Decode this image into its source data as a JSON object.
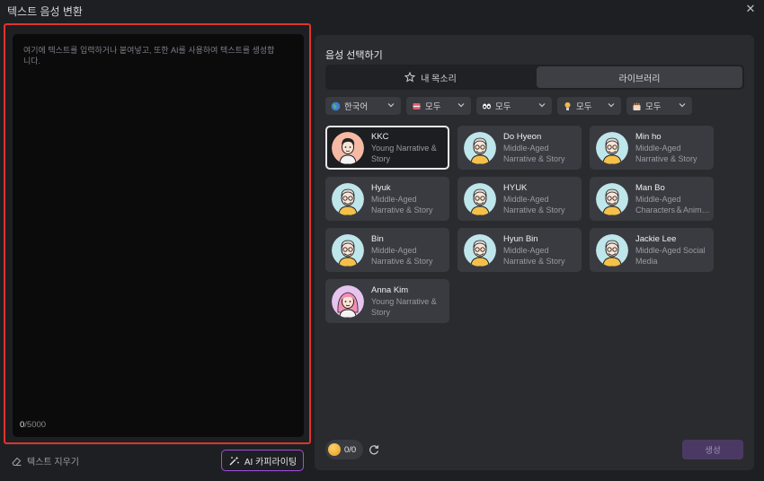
{
  "window": {
    "title": "텍스트 음성 변환",
    "close_icon": "close-icon"
  },
  "editor": {
    "placeholder": "여기에 텍스트를 입력하거나 붙여넣고, 또한 AI를 사용하여 텍스트를 생성합니다.",
    "count_current": "0",
    "count_max": "/5000"
  },
  "actions": {
    "clear_label": "텍스트 지우기",
    "ai_label": "AI 카피라이팅"
  },
  "voice_panel": {
    "title": "음성 선택하기",
    "tabs": [
      {
        "label": "내 목소리",
        "icon": "star-icon",
        "active": false
      },
      {
        "label": "라이브러리",
        "icon": "",
        "active": true
      }
    ],
    "filters": [
      {
        "label": "한국어",
        "icon": "globe-icon"
      },
      {
        "label": "모두",
        "icon": "gender-icon"
      },
      {
        "label": "모두",
        "icon": "age-icon"
      },
      {
        "label": "모두",
        "icon": "style-icon"
      },
      {
        "label": "모두",
        "icon": "scene-icon"
      }
    ],
    "voices": [
      {
        "name": "KKC",
        "desc": "Young Narrative & Story",
        "selected": true,
        "avatar": "young-male-avatar"
      },
      {
        "name": "Do Hyeon",
        "desc": "Middle-Aged Narrative & Story",
        "selected": false,
        "avatar": "middle-aged-male-avatar"
      },
      {
        "name": "Min ho",
        "desc": "Middle-Aged Narrative & Story",
        "selected": false,
        "avatar": "middle-aged-male-avatar"
      },
      {
        "name": "Hyuk",
        "desc": "Middle-Aged Narrative & Story",
        "selected": false,
        "avatar": "middle-aged-male-avatar"
      },
      {
        "name": "HYUK",
        "desc": "Middle-Aged Narrative & Story",
        "selected": false,
        "avatar": "middle-aged-male-avatar"
      },
      {
        "name": "Man Bo",
        "desc": "Middle-Aged Characters＆Anima...",
        "selected": false,
        "avatar": "middle-aged-male-avatar"
      },
      {
        "name": "Bin",
        "desc": "Middle-Aged Narrative & Story",
        "selected": false,
        "avatar": "middle-aged-male-avatar"
      },
      {
        "name": "Hyun Bin",
        "desc": "Middle-Aged Narrative & Story",
        "selected": false,
        "avatar": "middle-aged-male-avatar"
      },
      {
        "name": "Jackie Lee",
        "desc": "Middle-Aged Social Media",
        "selected": false,
        "avatar": "middle-aged-male-avatar"
      },
      {
        "name": "Anna Kim",
        "desc": "Young Narrative & Story",
        "selected": false,
        "avatar": "young-female-avatar"
      }
    ],
    "credits": "0/0",
    "generate_label": "생성"
  },
  "colors": {
    "highlight_border": "#e0342c",
    "ai_border": "#a24ee5",
    "generate_bg": "#4a3a63"
  }
}
